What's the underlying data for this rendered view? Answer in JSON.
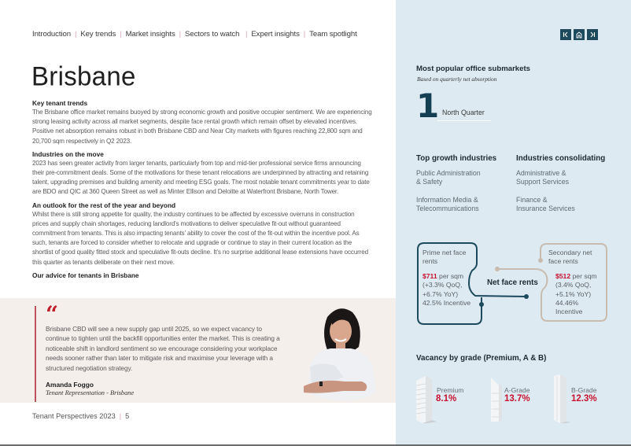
{
  "nav": {
    "items": [
      "Introduction",
      "Key trends",
      "Market insights",
      "Sectors to watch",
      "Expert insights",
      "Team spotlight"
    ]
  },
  "nav_buttons": {
    "prev": "prev-page-icon",
    "home": "home-icon",
    "next": "next-page-icon"
  },
  "page_title": "Brisbane",
  "sections": [
    {
      "heading": "Key tenant trends",
      "body": "The Brisbane office market remains buoyed by strong economic growth and positive occupier sentiment. We are experiencing strong leasing activity across all market segments, despite face rental growth which remain offset by elevated incentives. Positive net absorption remains robust in both Brisbane CBD and Near City markets with figures reaching 22,800 sqm and 20,700 sqm respectively in Q2 2023."
    },
    {
      "heading": "Industries on the move",
      "body": "2023 has seen greater activity from larger tenants, particularly from top and mid-tier professional service firms announcing their pre-commitment deals. Some of the motivations for these tenant relocations are underpinned by attracting and retaining talent, upgrading premises and building amenity and meeting ESG goals. The most notable tenant commitments year to date are BDO and QIC at 360 Queen Street as well as Minter Ellison and Deloitte at Waterfront Brisbane, North Tower."
    },
    {
      "heading": "An outlook for the rest of the year and beyond",
      "body": "Whilst there is still strong appetite for quality, the industry continues to be affected by excessive overruns in construction prices and supply chain shortages, reducing landlord’s motivations to deliver speculative fit-out without guaranteed commitment from tenants. This is also impacting tenants’ ability to cover the cost of the fit-out within the incentive pool. As such, tenants are forced to consider whether to relocate and upgrade or continue to stay in their current location as the shortlist of good quality fitted stock and speculative fit-outs decline. It’s no surprise additional lease extensions have occurred this quarter as tenants deliberate on their next move."
    },
    {
      "heading": "Our advice for tenants in Brisbane",
      "body": ""
    }
  ],
  "quote": {
    "mark": "“",
    "text": "Brisbane CBD will see a new supply gap until 2025, so we expect vacancy to continue to tighten until the backfill opportunities enter the market. This is creating a noticeable shift in landlord sentiment so we encourage considering your workplace needs sooner rather than later to mitigate risk and maximise your leverage with a structured negotiation strategy.",
    "name": "Amanda Foggo",
    "role": "Tenant Representation - Brisbane"
  },
  "footer": {
    "publication": "Tenant Perspectives 2023",
    "page_number": "5"
  },
  "submarkets": {
    "heading": "Most popular office submarkets",
    "subheading": "Based on quarterly net absorption",
    "rank": "1",
    "name": "North Quarter"
  },
  "industries": {
    "growth_heading": "Top growth industries",
    "growth": [
      "Public Administration\n& Safety",
      "Information Media &\nTelecommunications"
    ],
    "consolidating_heading": "Industries consolidating",
    "consolidating": [
      "Administrative &\nSupport Services",
      "Finance &\nInsurance Services"
    ]
  },
  "rents": {
    "center_label": "Net face rents",
    "prime": {
      "label": "Prime net face rents",
      "price": "$711",
      "unit": "per sqm",
      "change": "(+3.3% QoQ, +6.7% YoY)",
      "incentive": "42.5% Incentive"
    },
    "secondary": {
      "label": "Secondary net face rents",
      "price": "$512",
      "unit": "per sqm",
      "change": "(3.4% QoQ, +5.1% YoY)",
      "incentive": "44.46% Incentive"
    },
    "colors": {
      "prime": "#1d4a5c",
      "secondary": "#c9bcaf",
      "price": "#c8102e"
    }
  },
  "vacancy": {
    "heading": "Vacancy by grade (Premium, A & B)",
    "grades": [
      {
        "label": "Premium",
        "value": "8.1%"
      },
      {
        "label": "A-Grade",
        "value": "13.7%"
      },
      {
        "label": "B-Grade",
        "value": "12.3%"
      }
    ]
  }
}
